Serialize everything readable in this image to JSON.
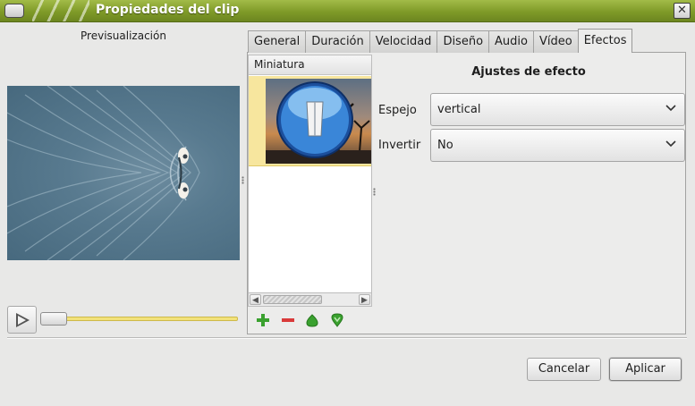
{
  "window": {
    "title": "Propiedades del clip",
    "close_glyph": "✕"
  },
  "preview": {
    "label": "Previsualización",
    "play_icon": "play-icon",
    "position_fraction": 0.0
  },
  "tabs": [
    {
      "label": "General",
      "active": false
    },
    {
      "label": "Duración",
      "active": false
    },
    {
      "label": "Velocidad",
      "active": false
    },
    {
      "label": "Diseño",
      "active": false
    },
    {
      "label": "Audio",
      "active": false
    },
    {
      "label": "Vídeo",
      "active": false
    },
    {
      "label": "Efectos",
      "active": true
    }
  ],
  "thumbnails": {
    "header": "Miniatura",
    "items": [
      {
        "icon": "effect-thumbnail-icon",
        "selected": true
      }
    ],
    "scroll_left": "◀",
    "scroll_right": "▶",
    "actions": [
      {
        "name": "add-effect-icon",
        "color": "#3aa12f"
      },
      {
        "name": "remove-effect-icon",
        "color": "#d93a3a"
      },
      {
        "name": "move-up-icon",
        "color": "#3aa12f"
      },
      {
        "name": "move-down-icon",
        "color": "#3aa12f"
      }
    ]
  },
  "settings": {
    "title": "Ajustes de efecto",
    "fields": [
      {
        "label": "Espejo",
        "value": "vertical"
      },
      {
        "label": "Invertir",
        "value": "No"
      }
    ]
  },
  "buttons": {
    "cancel": "Cancelar",
    "apply": "Aplicar"
  },
  "colors": {
    "titlebar": "#7f9a28",
    "selection": "#f7e69e",
    "slider": "#f2e27a"
  }
}
